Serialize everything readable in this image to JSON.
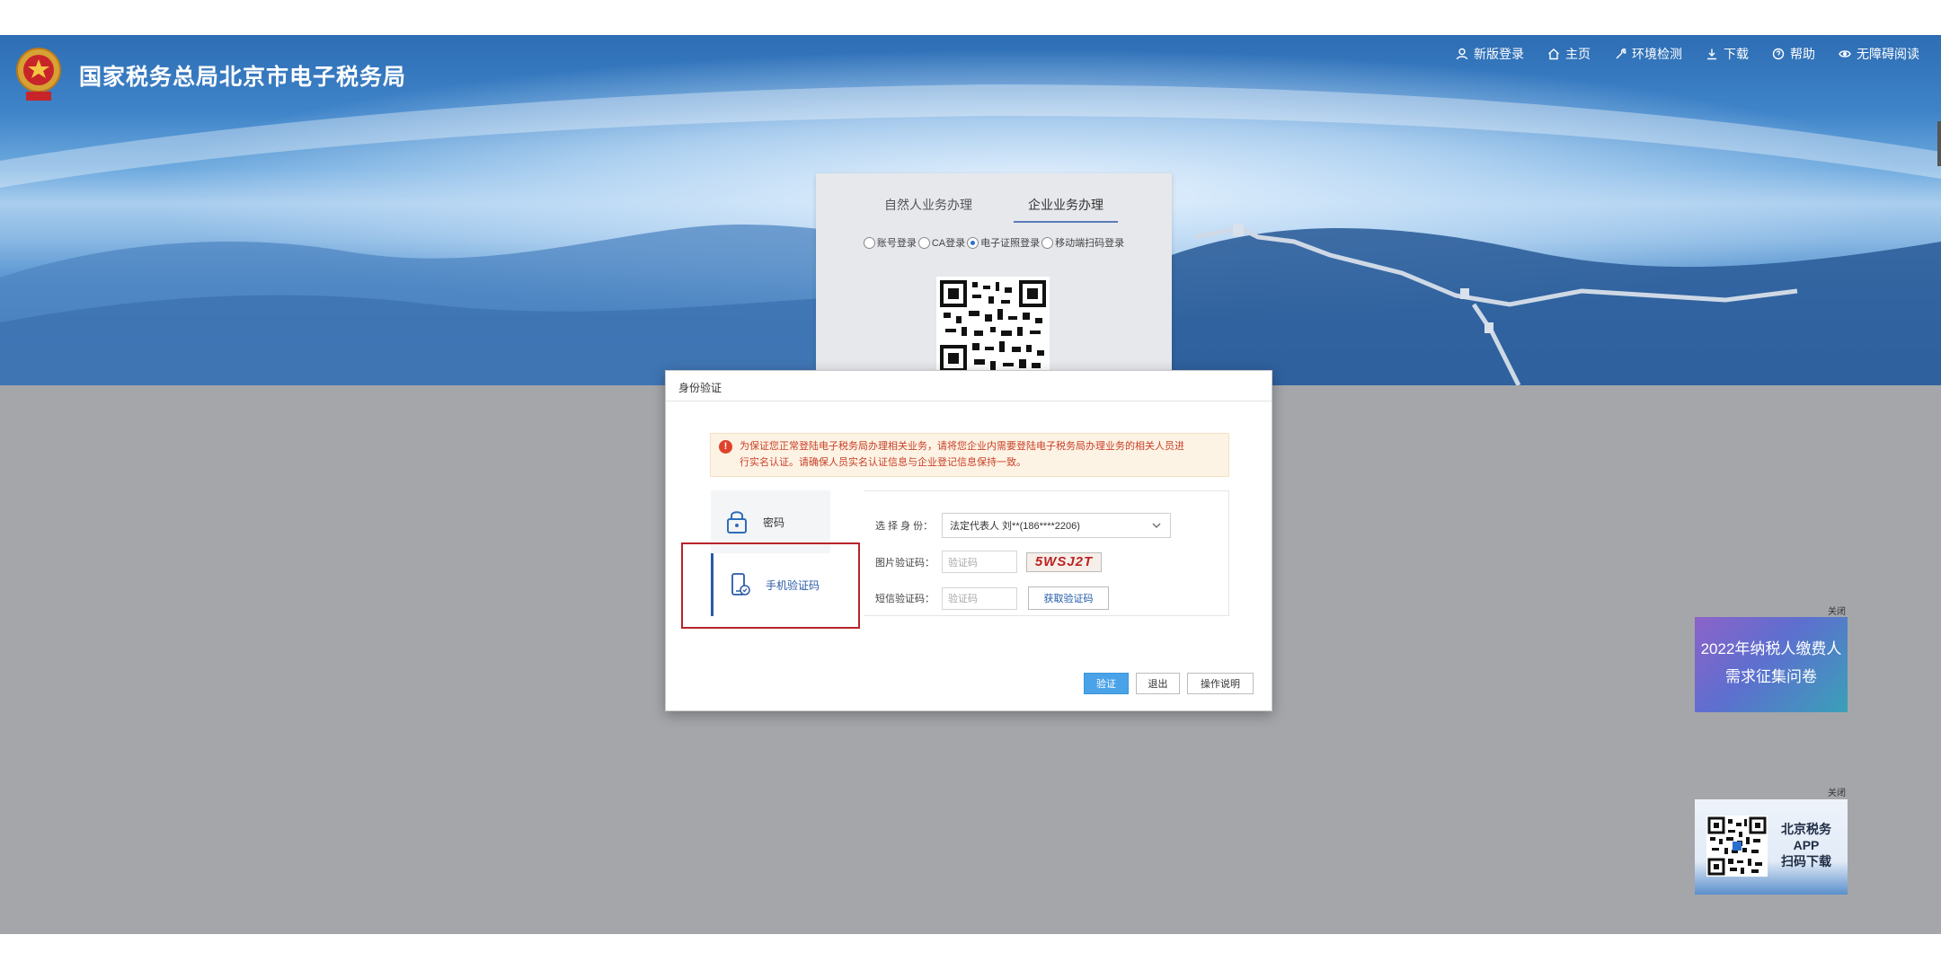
{
  "header": {
    "site_title": "国家税务总局北京市电子税务局",
    "emblem_text": "",
    "nav": [
      {
        "label": "新版登录",
        "icon": "user-icon"
      },
      {
        "label": "主页",
        "icon": "home-icon"
      },
      {
        "label": "环境检测",
        "icon": "wrench-icon"
      },
      {
        "label": "下载",
        "icon": "download-icon"
      },
      {
        "label": "帮助",
        "icon": "help-icon"
      },
      {
        "label": "无障碍阅读",
        "icon": "eye-icon"
      }
    ]
  },
  "login_card": {
    "tabs": [
      "自然人业务办理",
      "企业业务办理"
    ],
    "active_tab": 1,
    "radios": [
      "账号登录",
      "CA登录",
      "电子证照登录",
      "移动端扫码登录"
    ],
    "selected_radio": 2
  },
  "dialog": {
    "title": "身份验证",
    "alert_line1": "为保证您正常登陆电子税务局办理相关业务，请将您企业内需要登陆电子税务局办理业务的相关人员进",
    "alert_line2": "行实名认证。请确保人员实名认证信息与企业登记信息保持一致。",
    "side_tabs": [
      {
        "label": "密码",
        "icon": "lock-icon"
      },
      {
        "label": "手机验证码",
        "icon": "phone-icon"
      }
    ],
    "form": {
      "identity_label": "选 择 身 份：",
      "identity_value": "法定代表人 刘**(186****2206)",
      "captcha_label": "图片验证码：",
      "captcha_placeholder": "验证码",
      "captcha_text": "5WSJ2T",
      "sms_label": "短信验证码：",
      "sms_placeholder": "验证码",
      "sms_button": "获取验证码"
    },
    "buttons": {
      "verify": "验证",
      "exit": "退出",
      "help": "操作说明"
    }
  },
  "promo": {
    "close": "关闭",
    "line1": "2022年纳税人缴费人",
    "line2": "需求征集问卷"
  },
  "app_card": {
    "close": "关闭",
    "line1": "北京税务",
    "line2": "APP",
    "line3": "扫码下载"
  }
}
